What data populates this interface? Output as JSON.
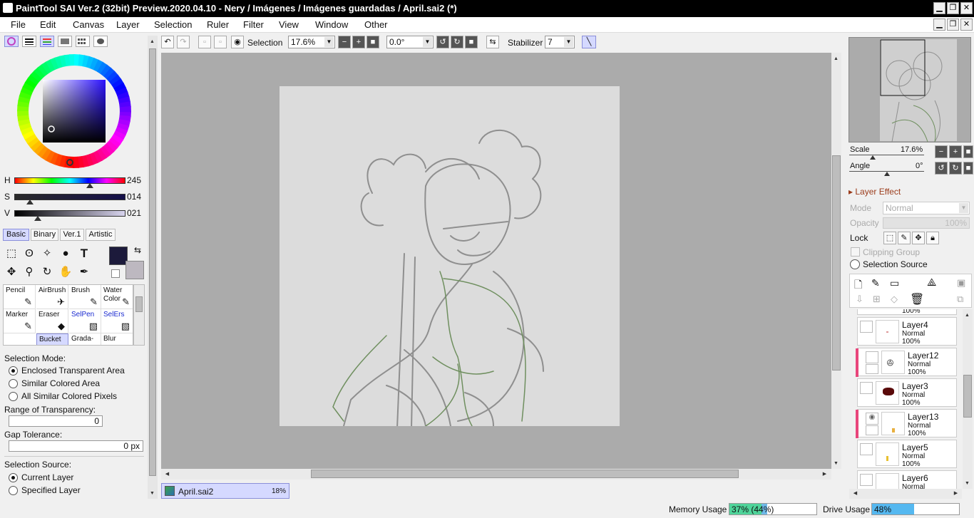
{
  "window": {
    "title": "PaintTool SAI Ver.2 (32bit) Preview.2020.04.10 - Nery / Imágenes / Imágenes guardadas / April.sai2 (*)",
    "minimize": "▁",
    "restore": "❐",
    "close": "✕"
  },
  "menu": [
    "File",
    "Edit",
    "Canvas",
    "Layer",
    "Selection",
    "Ruler",
    "Filter",
    "View",
    "Window",
    "Other"
  ],
  "color": {
    "h_label": "H",
    "h_value": "245",
    "s_label": "S",
    "s_value": "014",
    "v_label": "V",
    "v_value": "021",
    "h": 245,
    "s": 14,
    "v": 21,
    "primary": "#1c1a3b",
    "secondary": "#bdb8c0"
  },
  "tool_tabs": [
    "Basic",
    "Binary",
    "Ver.1",
    "Artistic"
  ],
  "brushes": [
    {
      "label": "Pencil",
      "icon": "✎"
    },
    {
      "label": "AirBrush",
      "icon": "✈"
    },
    {
      "label": "Brush",
      "icon": "✎"
    },
    {
      "label": "Water Color",
      "icon": "✎"
    },
    {
      "label": "Marker",
      "icon": "✎"
    },
    {
      "label": "Eraser",
      "icon": "◆"
    },
    {
      "label": "SelPen",
      "icon": "▧"
    },
    {
      "label": "SelErs",
      "icon": "▧"
    },
    {
      "label": "Bucket",
      "icon": ""
    },
    {
      "label": "Grada-",
      "icon": ""
    },
    {
      "label": "Blur",
      "icon": ""
    }
  ],
  "options": {
    "selection_mode_label": "Selection Mode:",
    "mode_options": [
      "Enclosed Transparent Area",
      "Similar Colored Area",
      "All Similar Colored Pixels"
    ],
    "range_label": "Range of Transparency:",
    "range_value": "0",
    "gap_label": "Gap Tolerance:",
    "gap_value": "0 px",
    "source_label": "Selection Source:",
    "source_options": [
      "Current Layer",
      "Specified Layer"
    ]
  },
  "canvas_toolbar": {
    "selection_label": "Selection",
    "zoom": "17.6%",
    "angle": "0.0°",
    "stabilizer_label": "Stabilizer",
    "stabilizer_value": "7"
  },
  "file_tab": {
    "name": "April.sai2",
    "zoom": "18%"
  },
  "navigator": {
    "scale_label": "Scale",
    "scale_value": "17.6%",
    "angle_label": "Angle",
    "angle_value": "0°"
  },
  "layer_panel": {
    "effect_label": "Layer Effect",
    "mode_label": "Mode",
    "mode_value": "Normal",
    "opacity_label": "Opacity",
    "opacity_value": "100%",
    "lock_label": "Lock",
    "clipping_label": "Clipping Group",
    "selsource_label": "Selection Source",
    "top_partial_opacity": "100%"
  },
  "layers": [
    {
      "name": "Layer4",
      "mode": "Normal",
      "opacity": "100%",
      "pink": false
    },
    {
      "name": "Layer12",
      "mode": "Normal",
      "opacity": "100%",
      "pink": true
    },
    {
      "name": "Layer3",
      "mode": "Normal",
      "opacity": "100%",
      "pink": false
    },
    {
      "name": "Layer13",
      "mode": "Normal",
      "opacity": "100%",
      "pink": true
    },
    {
      "name": "Layer5",
      "mode": "Normal",
      "opacity": "100%",
      "pink": false
    },
    {
      "name": "Layer6",
      "mode": "Normal",
      "opacity": "",
      "pink": false
    }
  ],
  "status": {
    "memory_label": "Memory Usage",
    "memory_value": "37% (44%)",
    "memory_fraction": 0.37,
    "drive_label": "Drive Usage",
    "drive_value": "48%",
    "drive_fraction": 0.48
  }
}
